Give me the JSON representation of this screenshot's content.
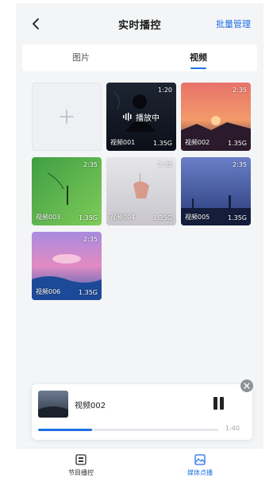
{
  "header": {
    "title": "实时播控",
    "batch_manage": "批量管理"
  },
  "tabs": [
    {
      "label": "图片",
      "active": false
    },
    {
      "label": "视频",
      "active": true
    }
  ],
  "videos": [
    {
      "name": "视频001",
      "duration": "1:20",
      "size": "1.35G",
      "playing": true,
      "status": "播放中"
    },
    {
      "name": "视频002",
      "duration": "2:35",
      "size": "1.35G"
    },
    {
      "name": "视频003",
      "duration": "2:35",
      "size": "1.35G"
    },
    {
      "name": "视频004",
      "duration": "2:35",
      "size": "1.35G"
    },
    {
      "name": "视频005",
      "duration": "2:35",
      "size": "1.35G"
    },
    {
      "name": "视频006",
      "duration": "2:35",
      "size": "1.35G"
    }
  ],
  "player": {
    "title": "视频002",
    "time": "1:40",
    "progress": 0.3
  },
  "bottom_nav": [
    {
      "label": "节目播控",
      "active": false
    },
    {
      "label": "媒体点播",
      "active": true
    }
  ],
  "colors": {
    "accent": "#1e6fe6",
    "background": "#f4f5f7"
  },
  "icons": {
    "back": "chevron-left-icon",
    "add": "plus-icon",
    "close": "close-icon",
    "pause": "pause-icon",
    "program": "program-icon",
    "media": "media-icon"
  }
}
